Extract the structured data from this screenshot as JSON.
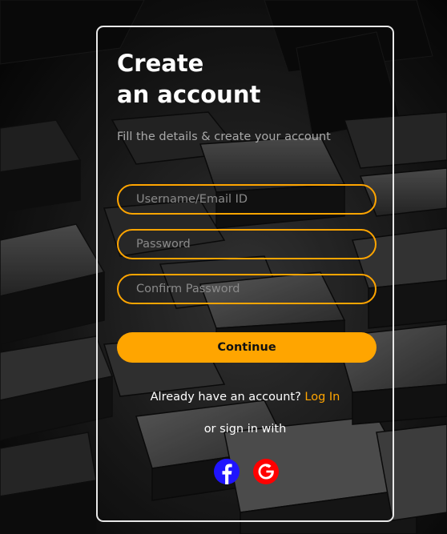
{
  "form": {
    "title_line1": "Create",
    "title_line2": "an account",
    "subtitle": "Fill the details & create your account",
    "username_placeholder": "Username/Email ID",
    "password_placeholder": "Password",
    "confirm_placeholder": "Confirm Password",
    "continue_label": "Continue",
    "have_account_text": "Already have an account? ",
    "login_label": "Log In",
    "or_sign_in_text": "or sign in with"
  },
  "social": {
    "facebook_icon": "facebook-icon",
    "google_icon": "google-icon"
  },
  "colors": {
    "accent": "#ffa500",
    "facebook": "#1f14ff",
    "google": "#ff0000",
    "background": "#050505"
  }
}
